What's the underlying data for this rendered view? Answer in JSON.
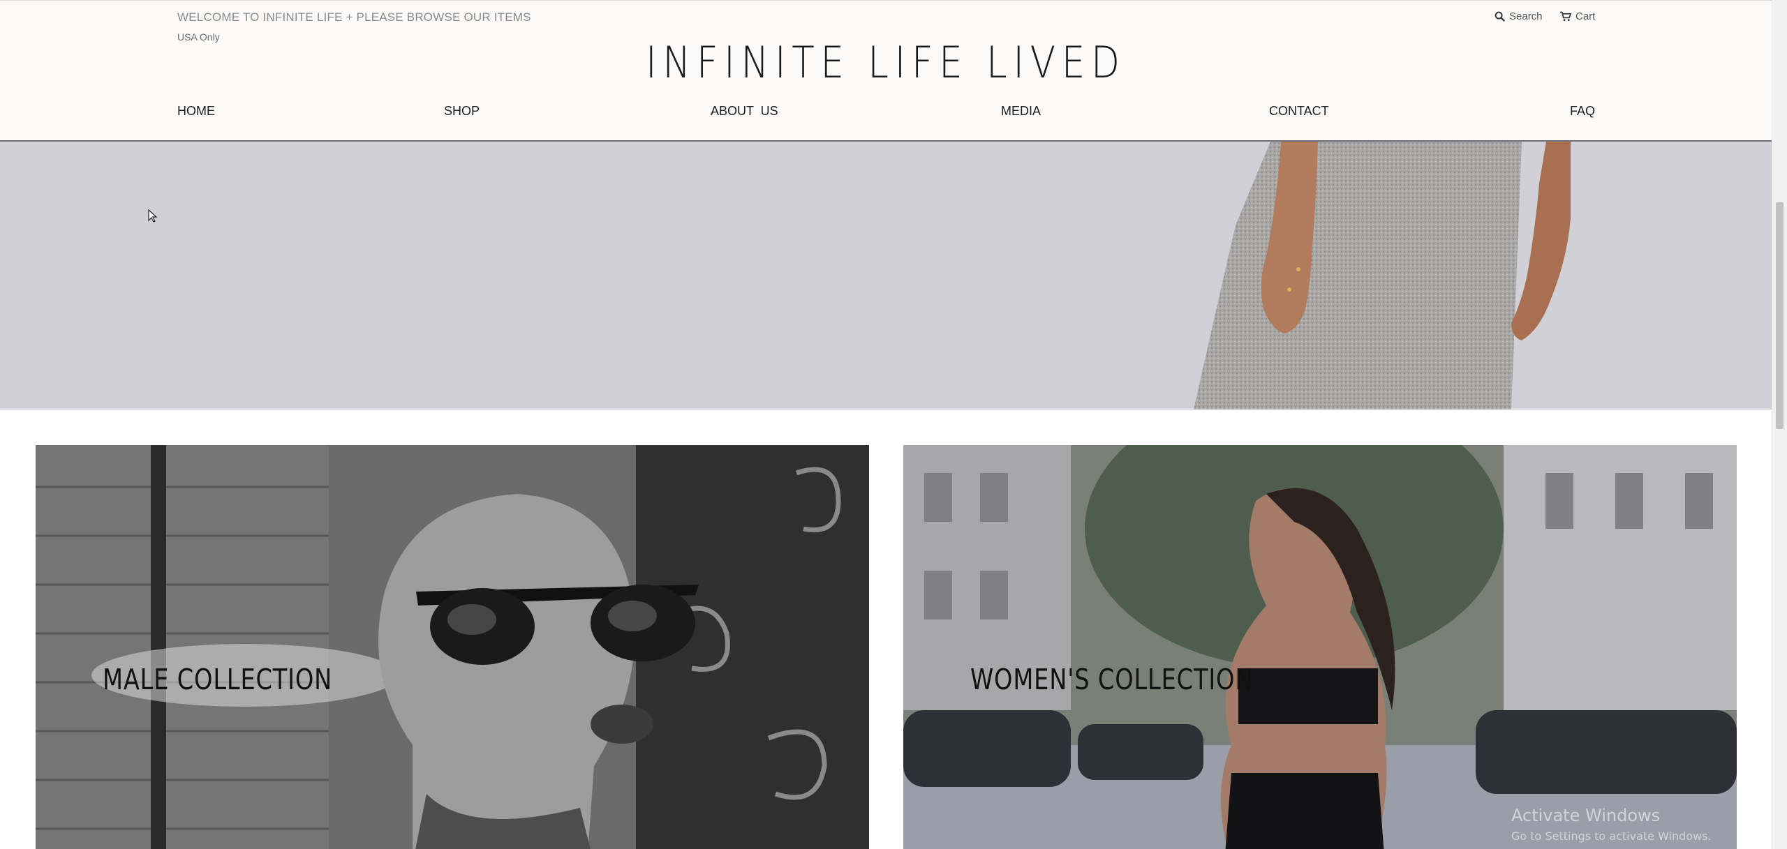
{
  "header": {
    "welcome": "WELCOME TO INFINITE LIFE + PLEASE BROWSE OUR ITEMS",
    "region": "USA Only",
    "search_label": "Search",
    "cart_label": "Cart",
    "logo": "INFINITE LIFE LIVED"
  },
  "nav": {
    "items": [
      {
        "label": "HOME"
      },
      {
        "label": "SHOP"
      },
      {
        "label": "ABOUT  US"
      },
      {
        "label": "MEDIA"
      },
      {
        "label": "CONTACT"
      },
      {
        "label": "FAQ"
      }
    ]
  },
  "collections": {
    "male_label": "MALE COLLECTION",
    "women_label": "WOMEN'S COLLECTION"
  },
  "watermark": {
    "title": "Activate Windows",
    "subtitle": "Go to Settings to activate Windows."
  },
  "colors": {
    "header_bg": "#fbfaf9",
    "hero_bg": "#d1d0d7",
    "header_border": "#6e6f7c",
    "text": "#1e1e1e"
  },
  "icons": {
    "search": "search-icon",
    "cart": "cart-icon"
  }
}
